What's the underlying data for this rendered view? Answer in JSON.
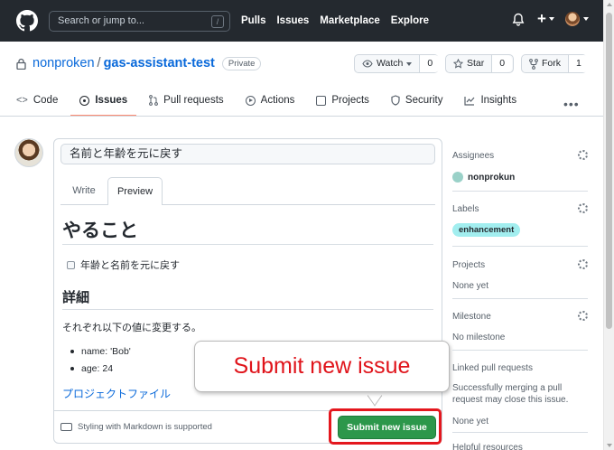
{
  "header": {
    "search_placeholder": "Search or jump to...",
    "search_shortcut": "/",
    "nav": [
      "Pulls",
      "Issues",
      "Marketplace",
      "Explore"
    ],
    "plus_label": "+"
  },
  "repo": {
    "owner": "nonproken",
    "separator": "/",
    "name": "gas-assistant-test",
    "visibility": "Private",
    "watch": {
      "label": "Watch",
      "count": "0"
    },
    "star": {
      "label": "Star",
      "count": "0"
    },
    "fork": {
      "label": "Fork",
      "count": "1"
    }
  },
  "tabs": [
    {
      "label": "Code",
      "icon": "code-icon"
    },
    {
      "label": "Issues",
      "icon": "issue-icon",
      "active": true
    },
    {
      "label": "Pull requests",
      "icon": "pull-request-icon"
    },
    {
      "label": "Actions",
      "icon": "play-icon"
    },
    {
      "label": "Projects",
      "icon": "table-icon"
    },
    {
      "label": "Security",
      "icon": "shield-icon"
    },
    {
      "label": "Insights",
      "icon": "graph-icon"
    }
  ],
  "issue": {
    "title_value": "名前と年齢を元に戻す",
    "write_tab": "Write",
    "preview_tab": "Preview",
    "preview": {
      "h1": "やること",
      "task": "年齢と名前を元に戻す",
      "h2": "詳細",
      "paragraph": "それぞれ以下の値に変更する。",
      "bullets": [
        "name: 'Bob'",
        "age: 24"
      ],
      "link": "プロジェクトファイル"
    },
    "markdown_note": "Styling with Markdown is supported",
    "submit_label": "Submit new issue"
  },
  "callout": {
    "text": "Submit new issue",
    "color": "#e0141b"
  },
  "sidebar": {
    "assignees": {
      "heading": "Assignees",
      "value": "nonprokun"
    },
    "labels": {
      "heading": "Labels",
      "value": "enhancement",
      "color": "#a2eeef"
    },
    "projects": {
      "heading": "Projects",
      "value": "None yet"
    },
    "milestone": {
      "heading": "Milestone",
      "value": "No milestone"
    },
    "linked_prs": {
      "heading": "Linked pull requests",
      "description": "Successfully merging a pull request may close this issue.",
      "value": "None yet"
    },
    "helpful": {
      "heading": "Helpful resources"
    }
  }
}
